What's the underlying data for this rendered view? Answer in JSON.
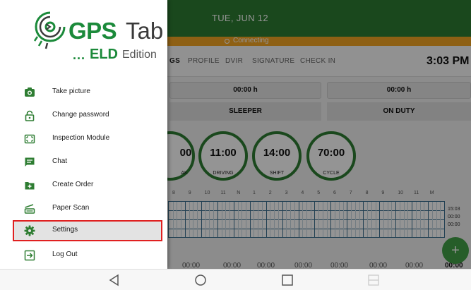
{
  "app": {
    "date": "TUE, JUN 12",
    "connection_status": "Connecting",
    "clock": "3:03 PM",
    "tabs": [
      {
        "label": "GS",
        "active": true
      },
      {
        "label": "PROFILE",
        "active": false
      },
      {
        "label": "DVIR",
        "active": false
      },
      {
        "label": "SIGNATURE",
        "active": false
      },
      {
        "label": "CHECK IN",
        "active": false
      }
    ],
    "status_times": [
      "00:00 h",
      "00:00 h"
    ],
    "status_buttons": [
      "SLEEPER",
      "ON DUTY"
    ],
    "gauges": [
      {
        "value": "00",
        "label": "AK"
      },
      {
        "value": "11:00",
        "label": "DRIVING"
      },
      {
        "value": "14:00",
        "label": "SHIFT"
      },
      {
        "value": "70:00",
        "label": "CYCLE"
      }
    ],
    "hours": [
      "8",
      "9",
      "10",
      "11",
      "N",
      "1",
      "2",
      "3",
      "4",
      "5",
      "6",
      "7",
      "8",
      "9",
      "10",
      "11",
      "M"
    ],
    "grid_totals": [
      "15:03",
      "00:00",
      "00:00"
    ],
    "fab_label": "+",
    "bottom_times": [
      "00:00",
      "00:00",
      "00:00",
      "00:00",
      "00:00",
      "00:00",
      "00:00",
      "00:00"
    ]
  },
  "drawer": {
    "logo": {
      "brand_bold": "GPS",
      "brand_light": "Tab",
      "dots": "...",
      "product": "ELD",
      "edition": "Edition"
    },
    "items": [
      {
        "label": "Take picture",
        "icon": "camera-icon"
      },
      {
        "label": "Change password",
        "icon": "lock-icon"
      },
      {
        "label": "Inspection Module",
        "icon": "inspection-icon"
      },
      {
        "label": "Chat",
        "icon": "chat-icon"
      },
      {
        "label": "Create Order",
        "icon": "add-order-icon"
      },
      {
        "label": "Paper Scan",
        "icon": "scanner-icon"
      },
      {
        "label": "Settings",
        "icon": "gear-icon",
        "selected": true
      },
      {
        "label": "Log Out",
        "icon": "logout-icon"
      }
    ]
  },
  "colors": {
    "brand_green": "#1b8a3a",
    "header_green": "#2e7d32",
    "connecting_bar": "#f5a623",
    "highlight_border": "#e02020"
  }
}
